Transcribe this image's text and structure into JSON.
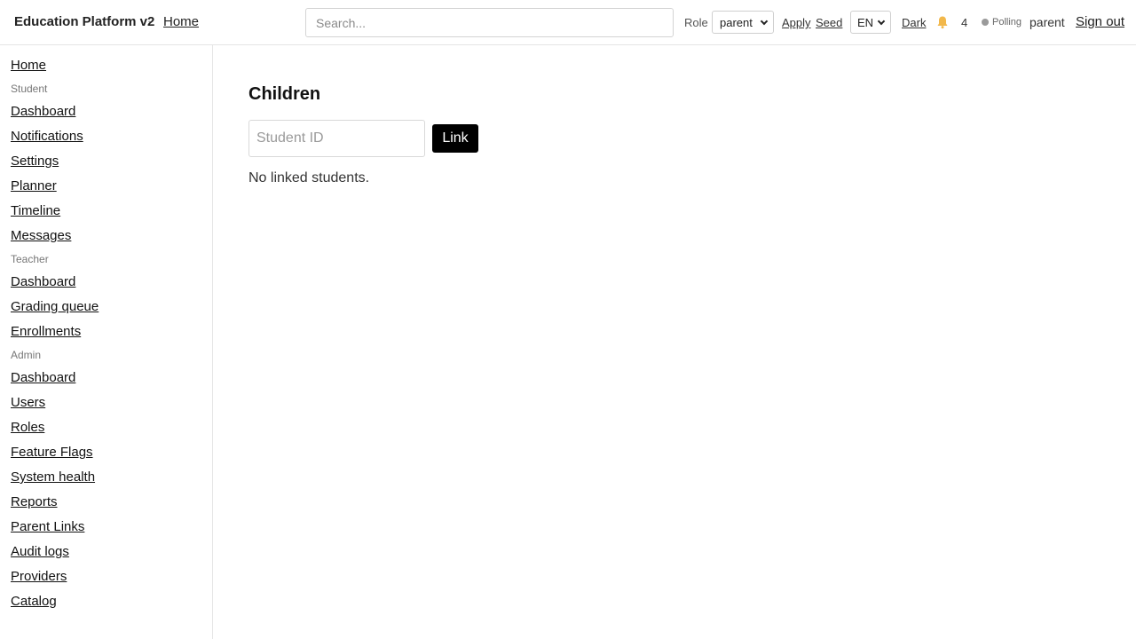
{
  "header": {
    "app_title": "Education Platform v2",
    "separator": "·",
    "home_label": "Home",
    "search_placeholder": "Search...",
    "role_label": "Role",
    "role_value": "parent",
    "apply_label": "Apply",
    "seed_label": "Seed",
    "language_value": "EN",
    "theme_label": "Dark",
    "notification_icon": "bell-icon",
    "notification_count": "4",
    "status_text": "Polling",
    "user_name": "parent",
    "signout_label": "Sign out"
  },
  "sidebar": {
    "home": "Home",
    "sections": [
      {
        "title": "Student",
        "items": [
          "Dashboard",
          "Notifications",
          "Settings",
          "Planner",
          "Timeline",
          "Messages"
        ]
      },
      {
        "title": "Teacher",
        "items": [
          "Dashboard",
          "Grading queue",
          "Enrollments"
        ]
      },
      {
        "title": "Admin",
        "items": [
          "Dashboard",
          "Users",
          "Roles",
          "Feature Flags",
          "System health",
          "Reports",
          "Parent Links",
          "Audit logs",
          "Providers",
          "Catalog"
        ]
      }
    ]
  },
  "main": {
    "title": "Children",
    "student_id_placeholder": "Student ID",
    "link_button_label": "Link",
    "empty_message": "No linked students."
  },
  "colors": {
    "bell": "#f2b84b",
    "status_dot": "#9a9a9a",
    "primary_button": "#000000"
  }
}
